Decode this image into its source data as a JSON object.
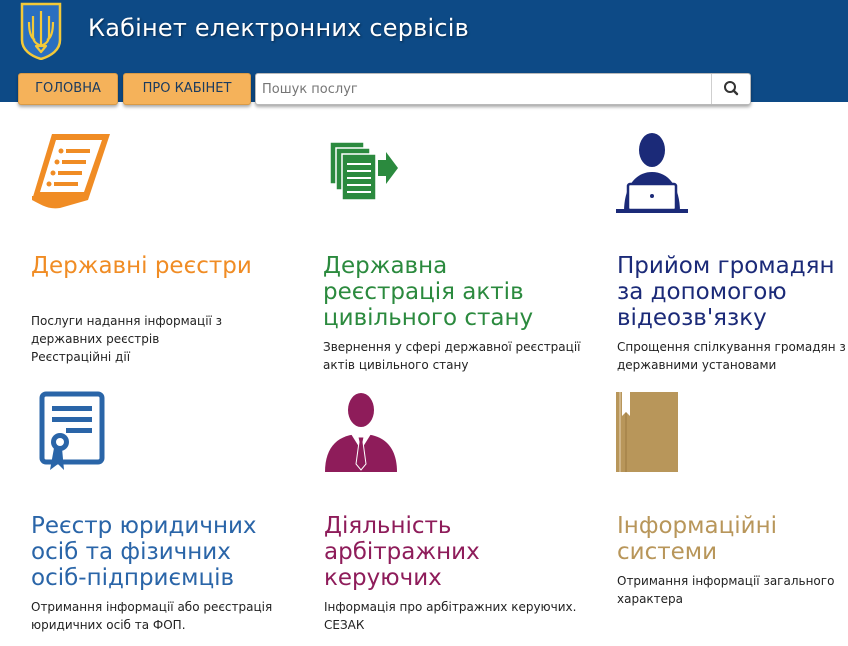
{
  "header": {
    "title": "Кабінет електронних сервісів"
  },
  "nav": {
    "home_label": "ГОЛОВНА",
    "about_label": "ПРО КАБІНЕТ"
  },
  "search": {
    "placeholder": "Пошук послуг",
    "value": ""
  },
  "colors": {
    "header_bg": "#0d4a86",
    "nav_button": "#f5b25a",
    "orange": "#f08c24",
    "green": "#2b8a3e",
    "navy": "#1b2a78",
    "blue": "#2a65a8",
    "maroon": "#8e1c5a",
    "tan": "#b8965a"
  },
  "services": [
    {
      "title": "Державні реєстри",
      "description": "Послуги надання інформації з\nдержавних реєстрів\nРеєстраційні дії",
      "icon": "document-scroll-icon"
    },
    {
      "title": "Державна\nреєстрація актів\nцивільного стану",
      "description": "Звернення у сфері державної реєстрації\nактів цивільного стану",
      "icon": "documents-arrow-icon"
    },
    {
      "title": "Прийом громадян\nза допомогою\nвідеозв'язку",
      "description": "Спрощення спілкування громадян з\nдержавними установами",
      "icon": "person-laptop-icon"
    },
    {
      "title": "Реєстр юридичних\nосіб та фізичних\nосіб-підприємців",
      "description": "Отримання інформації або реєстрація\nюридичних осіб та ФОП.",
      "icon": "certificate-icon"
    },
    {
      "title": "Діяльність\nарбітражних\nкеруючих",
      "description": "Інформація про арбітражних керуючих.\nСЕЗАК",
      "icon": "businessman-icon"
    },
    {
      "title": "Інформаційні\nсистеми",
      "description": "Отримання інформації загального\nхарактера",
      "icon": "book-icon"
    }
  ]
}
